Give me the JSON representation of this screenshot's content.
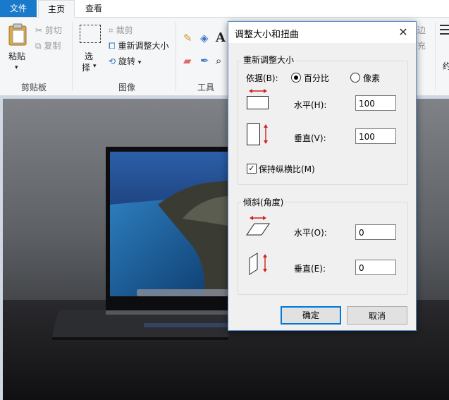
{
  "tabs": {
    "file": "文件",
    "home": "主页",
    "view": "查看"
  },
  "clipboard": {
    "paste": "粘贴",
    "cut": "剪切",
    "copy": "复制",
    "group": "剪贴板"
  },
  "image": {
    "select": "选",
    "select2": "择",
    "crop": "裁剪",
    "resize": "重新调整大小",
    "rotate": "旋转",
    "group": "图像"
  },
  "tools": {
    "group": "工具"
  },
  "right_edge": {
    "a": "边",
    "b": "充",
    "c": "约"
  },
  "dialog": {
    "title": "调整大小和扭曲",
    "close": "✕",
    "resize_group": "重新调整大小",
    "basis_label": "依据(B):",
    "percent": "百分比",
    "pixels": "像素",
    "horizontal_label": "水平(H):",
    "horizontal_value": "100",
    "vertical_label": "垂直(V):",
    "vertical_value": "100",
    "keep_ratio": "保持纵横比(M)",
    "skew_group": "倾斜(角度)",
    "skew_h_label": "水平(O):",
    "skew_h_value": "0",
    "skew_v_label": "垂直(E):",
    "skew_v_value": "0",
    "ok": "确定",
    "cancel": "取消"
  },
  "colors": {
    "accent": "#1979ca",
    "dialog_border": "#5a8fd0",
    "default_button": "#0078d7"
  }
}
